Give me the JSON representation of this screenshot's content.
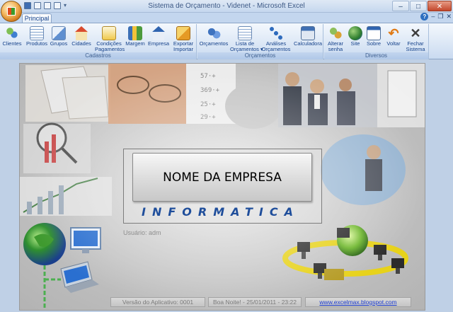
{
  "window": {
    "title": "Sistema de Orçamento - Videnet - Microsoft Excel",
    "controls": [
      "–",
      "□",
      "✕"
    ]
  },
  "tabs": [
    {
      "label": "Principal"
    }
  ],
  "ribbon_groups": [
    {
      "label": "Cadastros",
      "buttons": [
        {
          "label": "Clientes",
          "icon": "clients-icon"
        },
        {
          "label": "Produtos",
          "icon": "products-icon"
        },
        {
          "label": "Grupos",
          "icon": "groups-icon"
        },
        {
          "label": "Cidades",
          "icon": "house-icon"
        },
        {
          "label": "Condições\nPagamentos",
          "icon": "payment-conditions-icon"
        },
        {
          "label": "Margem",
          "icon": "margin-icon"
        },
        {
          "label": "Empresa",
          "icon": "company-icon"
        },
        {
          "label": "Exportar\nImportar",
          "icon": "export-import-icon"
        }
      ]
    },
    {
      "label": "Orçamentos",
      "buttons": [
        {
          "label": "Orçamentos",
          "icon": "quotes-icon"
        },
        {
          "label": "Lista de\nOrçamentos ▾",
          "icon": "quote-list-icon"
        },
        {
          "label": "Análises\nOrçamentos",
          "icon": "analysis-icon"
        },
        {
          "label": "Calculadora",
          "icon": "calculator-icon"
        }
      ]
    },
    {
      "label": "Diversos",
      "buttons": [
        {
          "label": "Alterar\nsenha",
          "icon": "change-password-icon"
        },
        {
          "label": "Site",
          "icon": "globe-icon"
        },
        {
          "label": "Sobre",
          "icon": "about-icon"
        },
        {
          "label": "Voltar",
          "icon": "back-arrow-icon"
        },
        {
          "label": "Fechar\nSistema",
          "icon": "close-system-icon"
        }
      ]
    }
  ],
  "main": {
    "company_name": "NOME DA EMPRESA",
    "brand_word": "INFORMATICA",
    "user": "Usuário: adm",
    "status": {
      "version": "Versão do Aplicativo:  0001",
      "greeting": "Boa Noite! - 25/01/2011  - 23:22",
      "link": "www.excelmax.blogspot.com"
    }
  }
}
